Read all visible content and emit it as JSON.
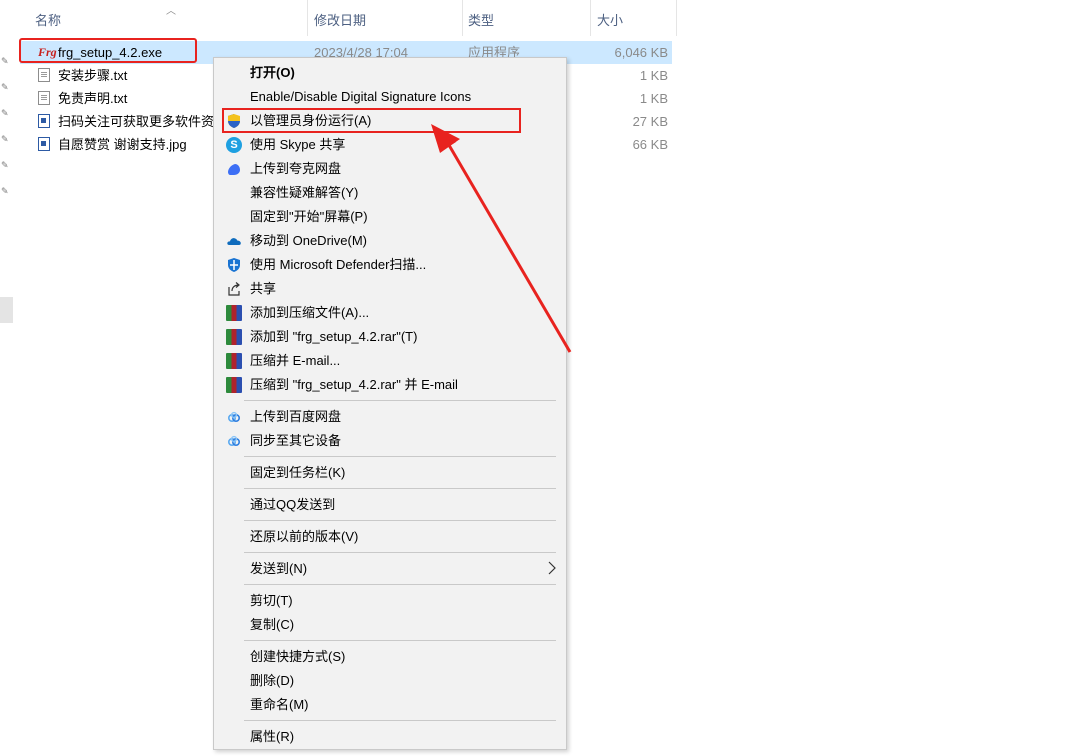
{
  "columns": {
    "name": "名称",
    "modified": "修改日期",
    "type": "类型",
    "size": "大小"
  },
  "files": [
    {
      "name": "frg_setup_4.2.exe",
      "modified": "2023/4/28 17:04",
      "type": "应用程序",
      "size": "6,046 KB",
      "icon": "exe-app-icon"
    },
    {
      "name": "安装步骤.txt",
      "modified": "",
      "type": "",
      "size": "1 KB",
      "icon": "text-file-icon"
    },
    {
      "name": "免责声明.txt",
      "modified": "",
      "type": "",
      "size": "1 KB",
      "icon": "text-file-icon"
    },
    {
      "name": "扫码关注可获取更多软件资",
      "modified": "",
      "type": "",
      "size": "27 KB",
      "icon": "image-file-icon"
    },
    {
      "name": "自愿赞赏 谢谢支持.jpg",
      "modified": "",
      "type": "",
      "size": "66 KB",
      "icon": "image-file-icon"
    }
  ],
  "context_menu": {
    "items": [
      {
        "label": "打开(O)",
        "icon": ""
      },
      {
        "label": "Enable/Disable Digital Signature Icons",
        "icon": ""
      },
      {
        "label": "以管理员身份运行(A)",
        "icon": "uac-shield-icon"
      },
      {
        "label": "使用 Skype 共享",
        "icon": "skype-icon"
      },
      {
        "label": "上传到夸克网盘",
        "icon": "quark-cloud-icon"
      },
      {
        "label": "兼容性疑难解答(Y)",
        "icon": ""
      },
      {
        "label": "固定到\"开始\"屏幕(P)",
        "icon": ""
      },
      {
        "label": "移动到 OneDrive(M)",
        "icon": "onedrive-icon"
      },
      {
        "label": "使用 Microsoft Defender扫描...",
        "icon": "defender-icon"
      },
      {
        "label": "共享",
        "icon": "share-icon"
      },
      {
        "label": "添加到压缩文件(A)...",
        "icon": "winrar-icon"
      },
      {
        "label": "添加到 \"frg_setup_4.2.rar\"(T)",
        "icon": "winrar-icon"
      },
      {
        "label": "压缩并 E-mail...",
        "icon": "winrar-icon"
      },
      {
        "label": "压缩到 \"frg_setup_4.2.rar\" 并 E-mail",
        "icon": "winrar-icon"
      },
      {
        "label": "上传到百度网盘",
        "icon": "baidu-netdisk-icon"
      },
      {
        "label": "同步至其它设备",
        "icon": "baidu-netdisk-icon"
      },
      {
        "label": "固定到任务栏(K)",
        "icon": ""
      },
      {
        "label": "通过QQ发送到",
        "icon": ""
      },
      {
        "label": "还原以前的版本(V)",
        "icon": ""
      },
      {
        "label": "发送到(N)",
        "icon": ""
      },
      {
        "label": "剪切(T)",
        "icon": ""
      },
      {
        "label": "复制(C)",
        "icon": ""
      },
      {
        "label": "创建快捷方式(S)",
        "icon": ""
      },
      {
        "label": "删除(D)",
        "icon": ""
      },
      {
        "label": "重命名(M)",
        "icon": ""
      },
      {
        "label": "属性(R)",
        "icon": ""
      }
    ]
  },
  "colors": {
    "annotation": "#e8231f",
    "selection": "#cce8ff",
    "menu_background": "#f2f2f2"
  }
}
